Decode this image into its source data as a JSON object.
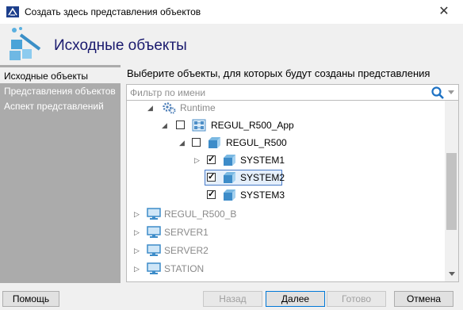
{
  "window": {
    "title": "Создать здесь представления объектов",
    "close_glyph": "✕",
    "app_icon": "app-logo-icon"
  },
  "header": {
    "title": "Исходные объекты",
    "icon": "magic-wand-objects-icon"
  },
  "sidebar": {
    "items": [
      {
        "label": "Исходные объекты",
        "active": true
      },
      {
        "label": "Представления объектов",
        "active": false
      },
      {
        "label": "Аспект представлений",
        "active": false
      }
    ]
  },
  "main": {
    "instruction": "Выберите объекты, для которых будут созданы представления",
    "filter": {
      "placeholder": "Фильтр по имени",
      "value": ""
    }
  },
  "tree": {
    "nodes": [
      {
        "label": "Runtime",
        "expander": "◢",
        "checkbox": false,
        "icon": "runtime-gears-icon",
        "gray": true
      },
      {
        "label": "REGUL_R500_App",
        "expander": "◢",
        "checkbox": true,
        "checked": false,
        "icon": "app-blocks-icon"
      },
      {
        "label": "REGUL_R500",
        "expander": "◢",
        "checkbox": true,
        "checked": false,
        "icon": "cube-icon"
      },
      {
        "label": "SYSTEM1",
        "expander": "▷",
        "checkbox": true,
        "checked": true,
        "icon": "cube-icon"
      },
      {
        "label": "SYSTEM2",
        "expander": "",
        "checkbox": true,
        "checked": true,
        "icon": "cube-icon",
        "selected": true
      },
      {
        "label": "SYSTEM3",
        "expander": "",
        "checkbox": true,
        "checked": true,
        "icon": "cube-icon"
      },
      {
        "label": "REGUL_R500_B",
        "expander": "▷",
        "checkbox": false,
        "icon": "computer-icon",
        "gray": true
      },
      {
        "label": "SERVER1",
        "expander": "▷",
        "checkbox": false,
        "icon": "computer-icon",
        "gray": true
      },
      {
        "label": "SERVER2",
        "expander": "▷",
        "checkbox": false,
        "icon": "computer-icon",
        "gray": true
      },
      {
        "label": "STATION",
        "expander": "▷",
        "checkbox": false,
        "icon": "computer-icon",
        "gray": true
      }
    ]
  },
  "buttons": {
    "help": "Помощь",
    "back": "Назад",
    "next": "Далее",
    "done": "Готово",
    "cancel": "Отмена"
  },
  "colors": {
    "accent": "#0078d7",
    "title_text": "#1a1a6e",
    "sidebar_bg": "#ababab",
    "selection": "#e5effb"
  }
}
